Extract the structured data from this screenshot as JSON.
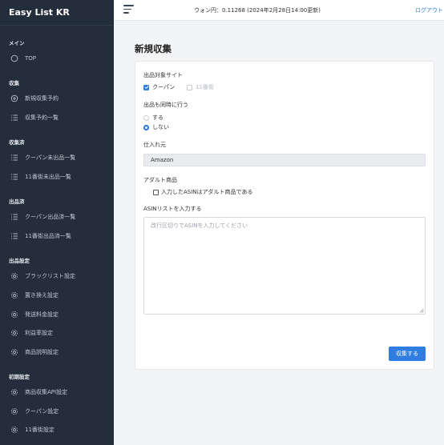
{
  "app": {
    "title": "Easy List KR"
  },
  "topbar": {
    "rate_text": "ウォン円：0.11268 (2024年2月28日14:00更新)",
    "logout_label": "ログアウト"
  },
  "sidebar": {
    "sections": [
      {
        "title": "メイン",
        "items": [
          {
            "label": "TOP",
            "icon": "circle-icon"
          }
        ]
      },
      {
        "title": "収集",
        "items": [
          {
            "label": "新規収集予約",
            "icon": "plus-circle-icon"
          },
          {
            "label": "収集予約一覧",
            "icon": "list-icon"
          }
        ]
      },
      {
        "title": "収集済",
        "items": [
          {
            "label": "クーパン未出品一覧",
            "icon": "list-icon"
          },
          {
            "label": "11番街未出品一覧",
            "icon": "list-icon"
          }
        ]
      },
      {
        "title": "出品済",
        "items": [
          {
            "label": "クーパン出品済一覧",
            "icon": "list-icon"
          },
          {
            "label": "11番街出品済一覧",
            "icon": "list-icon"
          }
        ]
      },
      {
        "title": "出品設定",
        "items": [
          {
            "label": "ブラックリスト設定",
            "icon": "gear-icon"
          },
          {
            "label": "置き換え設定",
            "icon": "gear-icon"
          },
          {
            "label": "発送料金設定",
            "icon": "gear-icon"
          },
          {
            "label": "利益率設定",
            "icon": "gear-icon"
          },
          {
            "label": "商品説明設定",
            "icon": "gear-icon"
          }
        ]
      },
      {
        "title": "初期設定",
        "items": [
          {
            "label": "商品収集API設定",
            "icon": "gear-icon"
          },
          {
            "label": "クーパン設定",
            "icon": "gear-icon"
          },
          {
            "label": "11番街設定",
            "icon": "gear-icon"
          }
        ]
      }
    ]
  },
  "main": {
    "page_title": "新規収集",
    "form": {
      "site_label": "出品対象サイト",
      "site_options": [
        {
          "label": "クーパン",
          "checked": true
        },
        {
          "label": "11番街",
          "checked": false
        }
      ],
      "simul_label": "出品も同時に行う",
      "simul_options": [
        {
          "label": "する",
          "selected": false
        },
        {
          "label": "しない",
          "selected": true
        }
      ],
      "supplier_label": "仕入れ元",
      "supplier_value": "Amazon",
      "adult_label": "アダルト商品",
      "adult_checkbox_label": "入力したASINはアダルト商品である",
      "asin_label": "ASINリストを入力する",
      "asin_placeholder": "改行区切りでASINを入力してください",
      "asin_value": "",
      "submit_label": "収集する"
    }
  },
  "colors": {
    "sidebar_bg": "#232d3b",
    "accent": "#2f7de1",
    "page_bg": "#f3f4f6"
  }
}
